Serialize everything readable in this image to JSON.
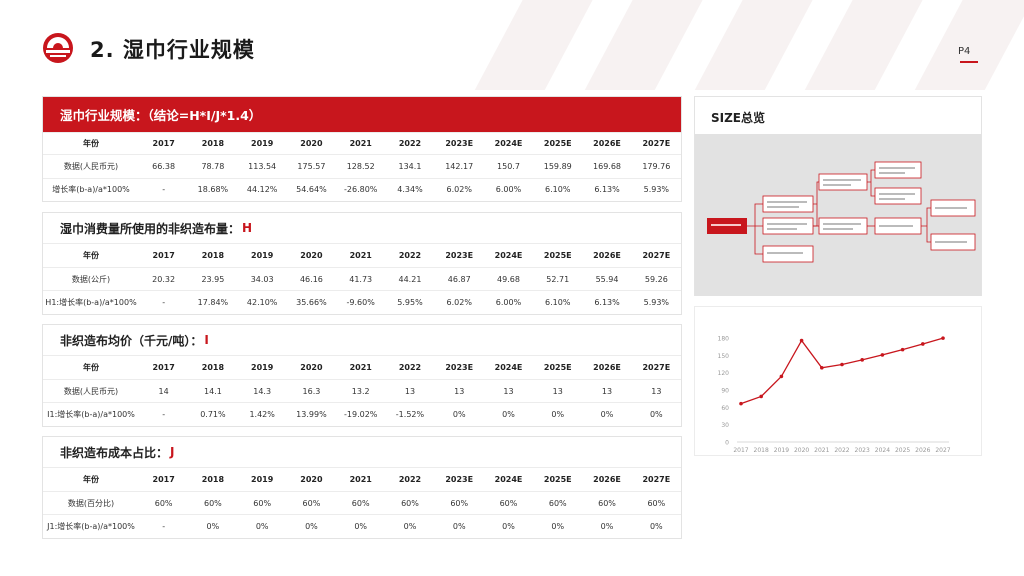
{
  "page": {
    "title": "2.  湿巾行业规模",
    "page_number": "P4",
    "colors": {
      "accent": "#c8161d",
      "panel_gray": "#e2e2e2"
    }
  },
  "blocks": [
    {
      "title_main": "湿巾行业规模：（结论=H*I/J*1.4）",
      "title_accent": "",
      "header": [
        "年份",
        "2017",
        "2018",
        "2019",
        "2020",
        "2021",
        "2022",
        "2023E",
        "2024E",
        "2025E",
        "2026E",
        "2027E"
      ],
      "rows": [
        [
          "数据(人民币元)",
          "66.38",
          "78.78",
          "113.54",
          "175.57",
          "128.52",
          "134.1",
          "142.17",
          "150.7",
          "159.89",
          "169.68",
          "179.76"
        ],
        [
          "增长率(b-a)/a*100%",
          "-",
          "18.68%",
          "44.12%",
          "54.64%",
          "-26.80%",
          "4.34%",
          "6.02%",
          "6.00%",
          "6.10%",
          "6.13%",
          "5.93%"
        ]
      ]
    },
    {
      "title_main": "湿巾消费量所使用的非织造布量：",
      "title_accent": "H",
      "header": [
        "年份",
        "2017",
        "2018",
        "2019",
        "2020",
        "2021",
        "2022",
        "2023E",
        "2024E",
        "2025E",
        "2026E",
        "2027E"
      ],
      "rows": [
        [
          "数据(公斤)",
          "20.32",
          "23.95",
          "34.03",
          "46.16",
          "41.73",
          "44.21",
          "46.87",
          "49.68",
          "52.71",
          "55.94",
          "59.26"
        ],
        [
          "H1:增长率(b-a)/a*100%",
          "-",
          "17.84%",
          "42.10%",
          "35.66%",
          "-9.60%",
          "5.95%",
          "6.02%",
          "6.00%",
          "6.10%",
          "6.13%",
          "5.93%"
        ]
      ]
    },
    {
      "title_main": "非织造布均价（千元/吨）：",
      "title_accent": "I",
      "header": [
        "年份",
        "2017",
        "2018",
        "2019",
        "2020",
        "2021",
        "2022",
        "2023E",
        "2024E",
        "2025E",
        "2026E",
        "2027E"
      ],
      "rows": [
        [
          "数据(人民币元)",
          "14",
          "14.1",
          "14.3",
          "16.3",
          "13.2",
          "13",
          "13",
          "13",
          "13",
          "13",
          "13"
        ],
        [
          "I1:增长率(b-a)/a*100%",
          "-",
          "0.71%",
          "1.42%",
          "13.99%",
          "-19.02%",
          "-1.52%",
          "0%",
          "0%",
          "0%",
          "0%",
          "0%"
        ]
      ]
    },
    {
      "title_main": "非织造布成本占比：",
      "title_accent": "J",
      "header": [
        "年份",
        "2017",
        "2018",
        "2019",
        "2020",
        "2021",
        "2022",
        "2023E",
        "2024E",
        "2025E",
        "2026E",
        "2027E"
      ],
      "rows": [
        [
          "数据(百分比)",
          "60%",
          "60%",
          "60%",
          "60%",
          "60%",
          "60%",
          "60%",
          "60%",
          "60%",
          "60%",
          "60%"
        ],
        [
          "J1:增长率(b-a)/a*100%",
          "-",
          "0%",
          "0%",
          "0%",
          "0%",
          "0%",
          "0%",
          "0%",
          "0%",
          "0%",
          "0%"
        ]
      ]
    }
  ],
  "size_panel": {
    "title": "SIZE总览"
  },
  "chart_data": {
    "type": "line",
    "x": [
      "2017",
      "2018",
      "2019",
      "2020",
      "2021",
      "2022",
      "2023",
      "2024",
      "2025",
      "2026",
      "2027"
    ],
    "series": [
      {
        "values": [
          66.38,
          78.78,
          113.54,
          175.57,
          128.52,
          134.1,
          142.17,
          150.7,
          159.89,
          169.68,
          179.76
        ],
        "color": "#c8161d"
      }
    ],
    "yticks": [
      "0",
      "30",
      "60",
      "90",
      "120",
      "150",
      "180"
    ],
    "ylim": [
      0,
      180
    ],
    "grid": false,
    "title": "",
    "xlabel": "",
    "ylabel": ""
  }
}
